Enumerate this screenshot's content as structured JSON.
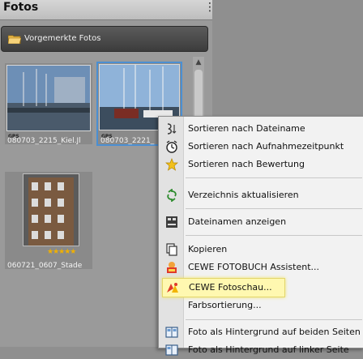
{
  "panel": {
    "title": "Fotos",
    "menu_glyph": "⋮"
  },
  "folder": {
    "label": "Vorgemerkte Fotos",
    "icon": "folder-icon"
  },
  "thumbnails": [
    {
      "caption": "080703_2215_Kiel.Jl",
      "gps": "GPS",
      "rating": 0
    },
    {
      "caption": "080703_2221_",
      "gps": "GPS",
      "rating": 0,
      "selected": true
    },
    {
      "caption": "060721_0607_Stade",
      "gps": "",
      "rating": 5
    }
  ],
  "rating_glyph": "★★★★★",
  "scroll_up_glyph": "▲",
  "context_menu": {
    "items": [
      {
        "label": "Sortieren nach Dateiname",
        "icon": "sort-az-icon"
      },
      {
        "label": "Sortieren nach Aufnahmezeitpunkt",
        "icon": "clock-icon"
      },
      {
        "label": "Sortieren nach Bewertung",
        "icon": "star-icon"
      },
      {
        "label": "Verzeichnis aktualisieren",
        "icon": "refresh-icon"
      },
      {
        "label": "Dateinamen anzeigen",
        "icon": "filename-icon"
      },
      {
        "label": "Kopieren",
        "icon": "copy-icon"
      },
      {
        "label": "CEWE FOTOBUCH Assistent...",
        "icon": "cewe-fotobuch-icon"
      },
      {
        "label": "CEWE Fotoschau...",
        "icon": "cewe-fotoschau-icon",
        "highlighted": true
      },
      {
        "label": "Farbsortierung...",
        "icon": ""
      },
      {
        "label": "Foto als Hintergrund auf beiden Seiten",
        "icon": "background-both-icon"
      },
      {
        "label": "Foto als Hintergrund auf linker Seite",
        "icon": "background-left-icon"
      }
    ]
  }
}
